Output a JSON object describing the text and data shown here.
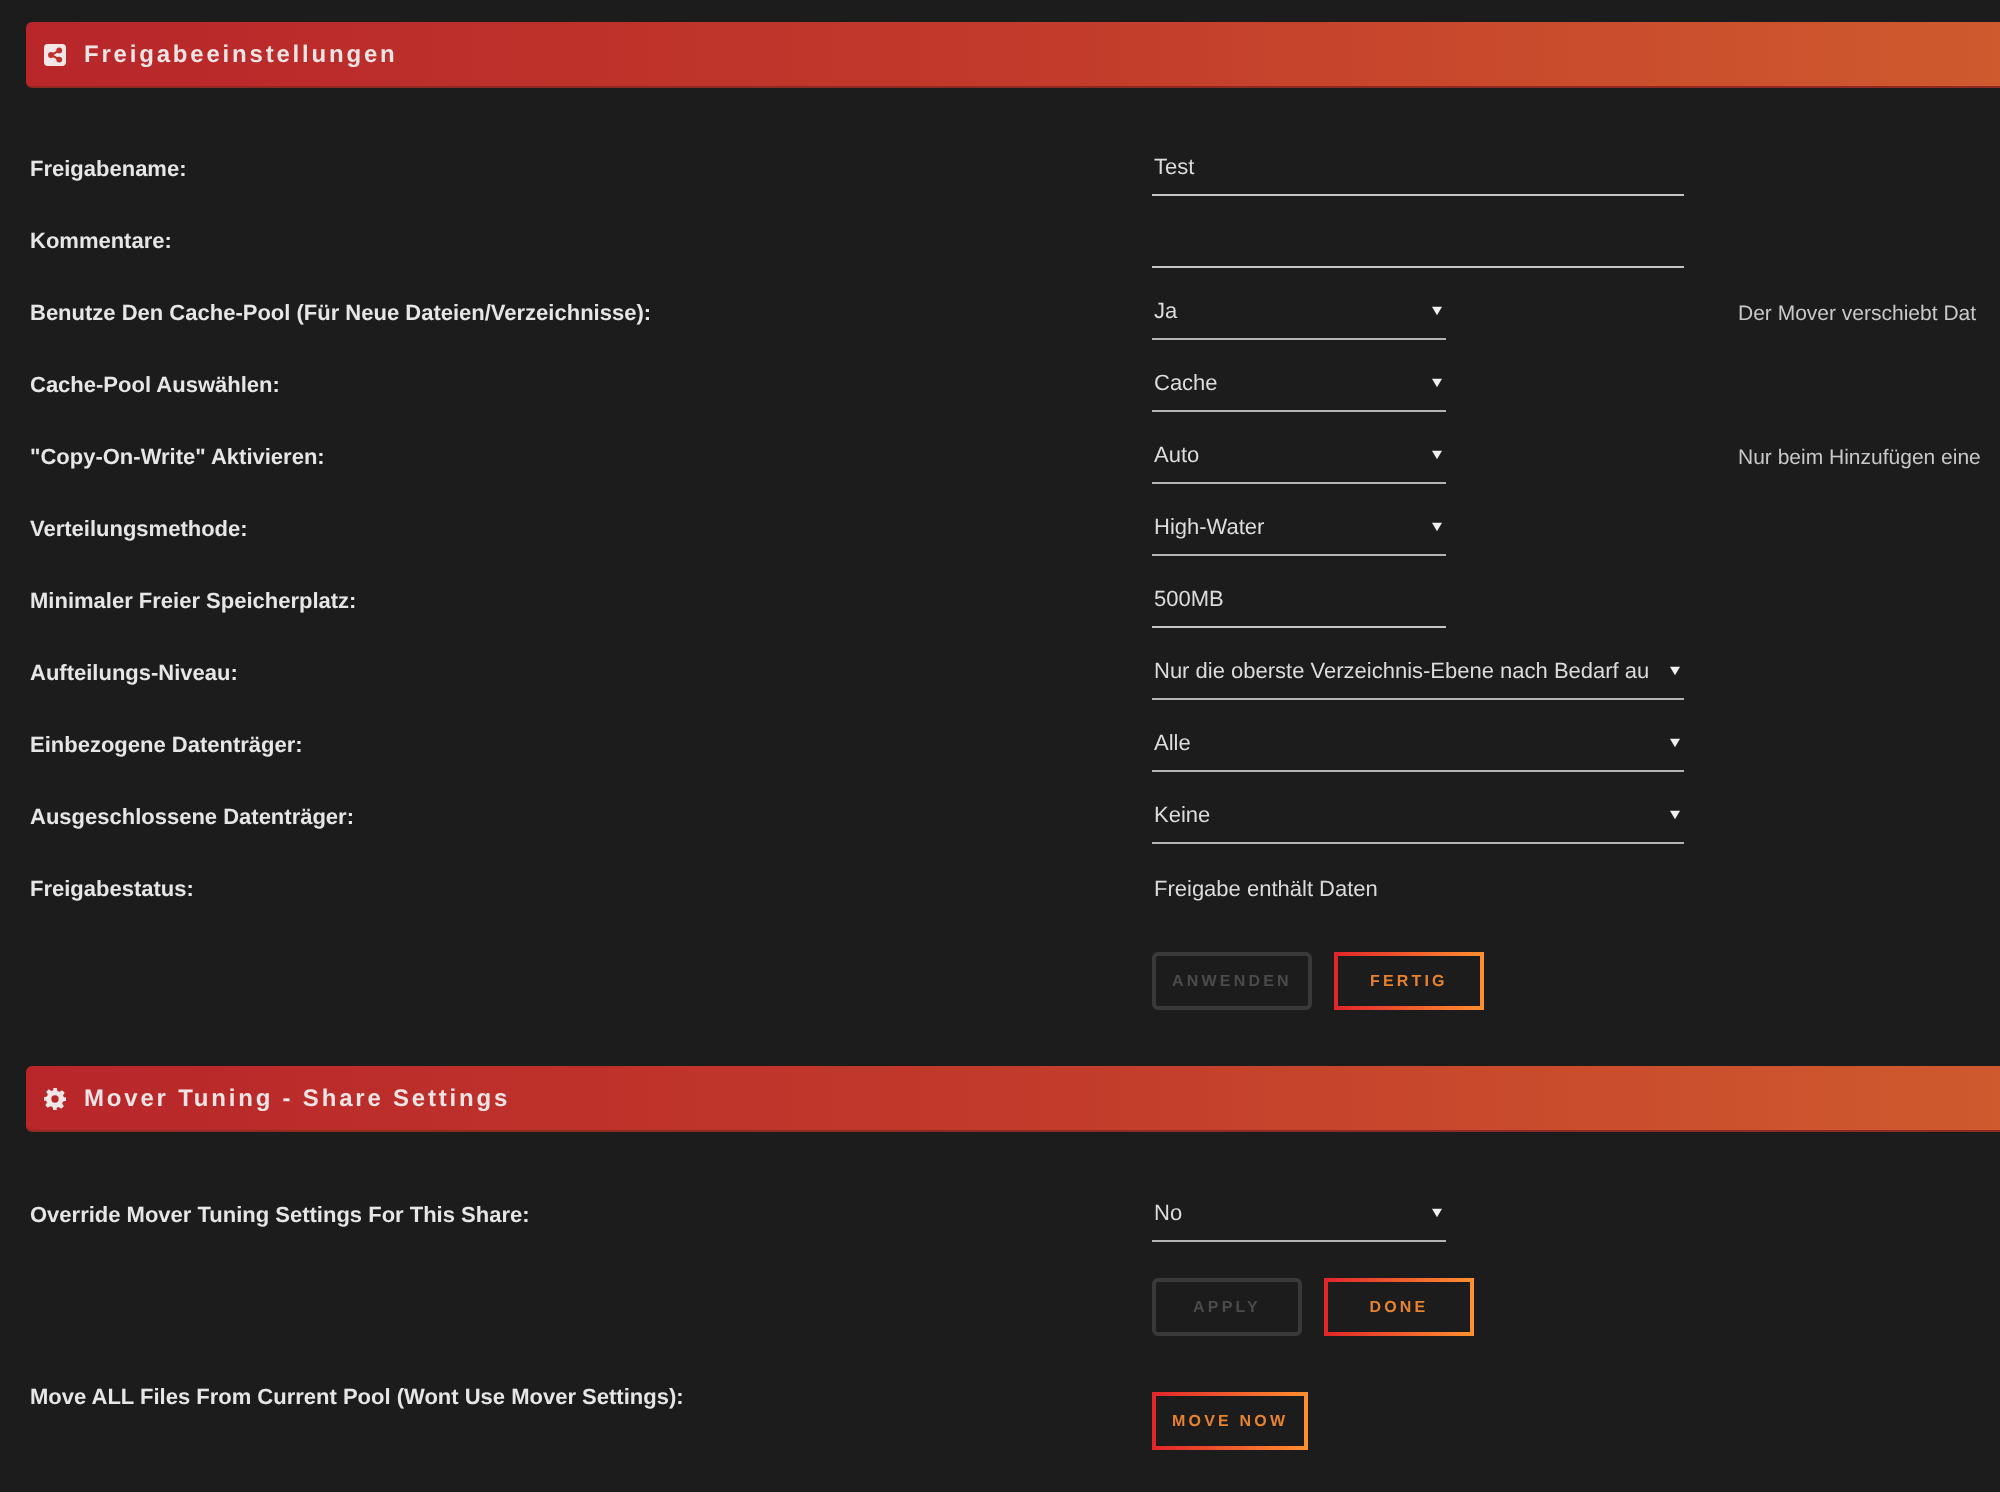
{
  "share_settings": {
    "title": "Freigabeeinstellungen",
    "items": [
      {
        "kind": "text",
        "label": "Freigabename:",
        "value": "Test"
      },
      {
        "kind": "text",
        "label": "Kommentare:"
      },
      {
        "kind": "select",
        "label": "Benutze Den Cache-Pool (Für Neue Dateien/Verzeichnisse):",
        "value": "Ja",
        "hint": "Der Mover verschiebt Dat"
      },
      {
        "kind": "select",
        "label": "Cache-Pool Auswählen:",
        "value": "Cache"
      },
      {
        "kind": "select",
        "label": "\"Copy-On-Write\" Aktivieren:",
        "value": "Auto",
        "hint": "Nur beim Hinzufügen eine"
      },
      {
        "kind": "select",
        "label": "Verteilungsmethode:",
        "value": "High-Water"
      },
      {
        "kind": "text",
        "label": "Minimaler Freier Speicherplatz:",
        "value": "500MB"
      },
      {
        "kind": "select",
        "label": "Aufteilungs-Niveau:",
        "value": "Nur die oberste Verzeichnis-Ebene nach Bedarf au"
      },
      {
        "kind": "select",
        "label": "Einbezogene Datenträger:",
        "value": "Alle"
      },
      {
        "kind": "select",
        "label": "Ausgeschlossene Datenträger:",
        "value": "Keine"
      },
      {
        "kind": "static",
        "label": "Freigabestatus:",
        "value": "Freigabe enthält Daten"
      },
      {
        "kind": "buttons",
        "buttons": [
          {
            "label": "ANWENDEN",
            "disabled": true
          },
          {
            "label": "FERTIG",
            "disabled": false
          }
        ]
      }
    ]
  },
  "mover_tuning": {
    "title": "Mover Tuning - Share Settings",
    "items": [
      {
        "kind": "select",
        "label": "Override Mover Tuning Settings For This Share:",
        "value": "No"
      },
      {
        "kind": "buttons",
        "buttons": [
          {
            "label": "APPLY",
            "disabled": true
          },
          {
            "label": "DONE",
            "disabled": false
          }
        ]
      },
      {
        "kind": "action",
        "label": "Move ALL Files From Current Pool (Wont Use Mover Settings):",
        "buttons": [
          {
            "label": "MOVE NOW",
            "disabled": false
          }
        ]
      }
    ]
  }
}
